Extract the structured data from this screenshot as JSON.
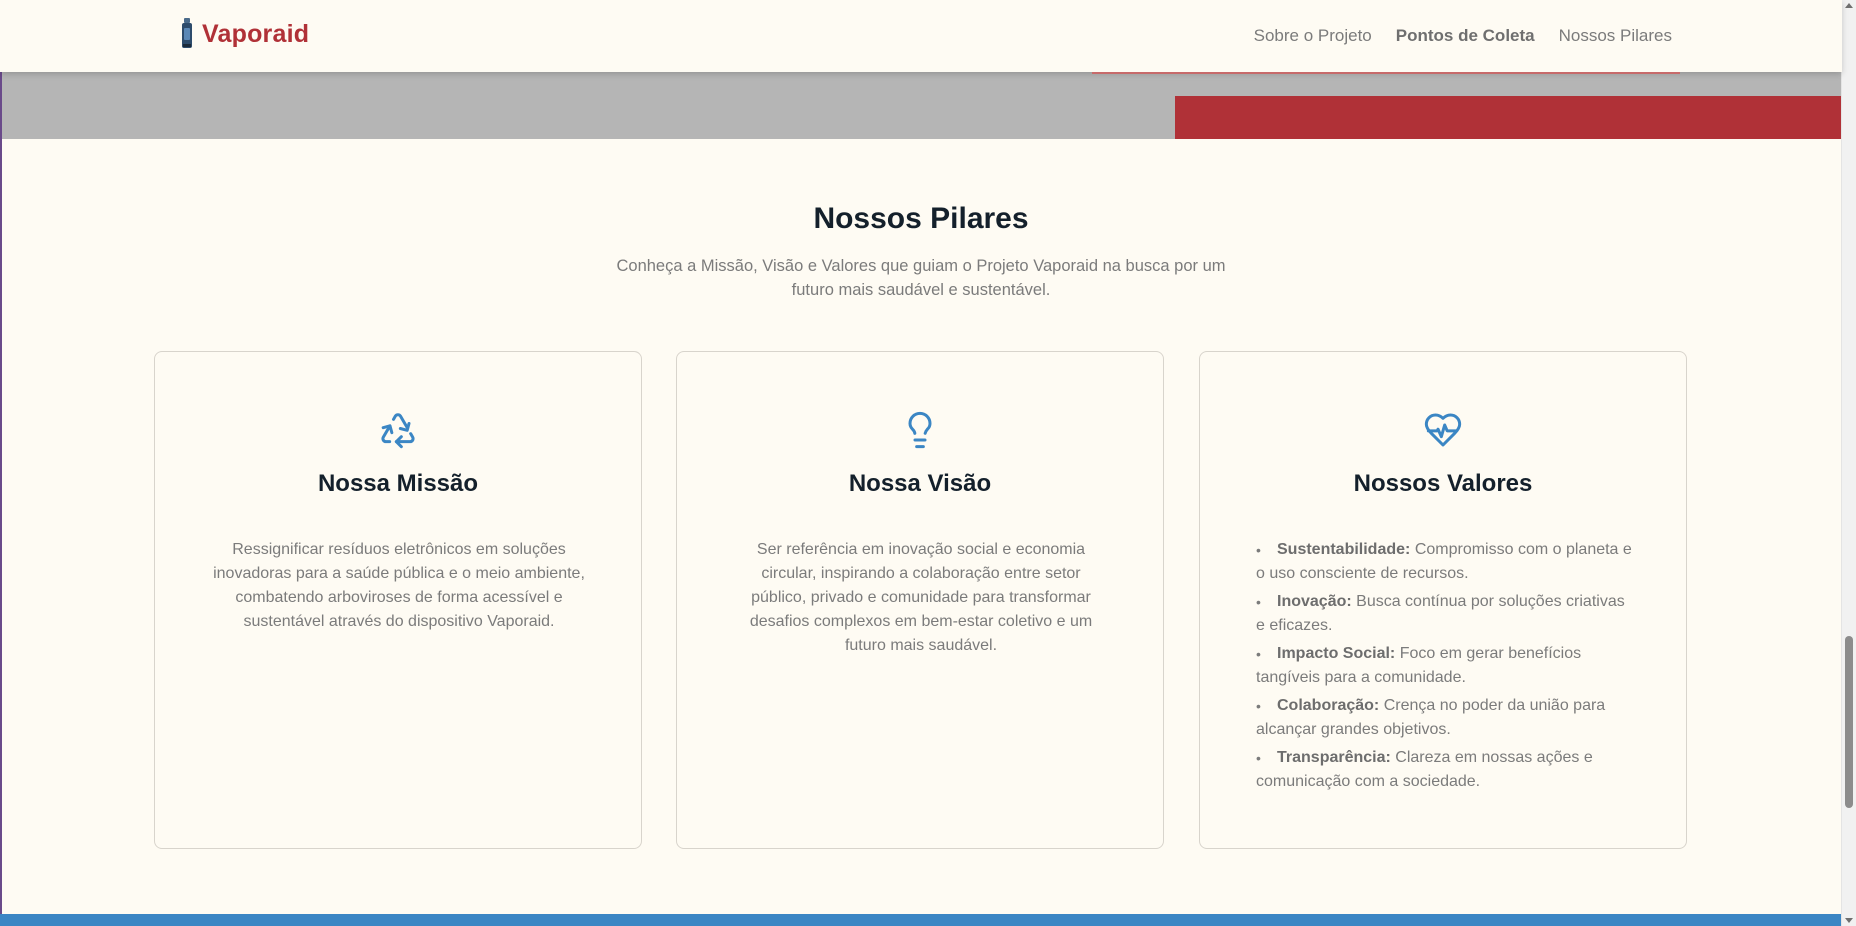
{
  "header": {
    "brand_name": "Vaporaid",
    "brand_icon": "device-bottle-icon",
    "nav": [
      {
        "label": "Sobre o Projeto",
        "active": false
      },
      {
        "label": "Pontos de Coleta",
        "active": true
      },
      {
        "label": "Nossos Pilares",
        "active": false
      }
    ]
  },
  "section": {
    "title": "Nossos Pilares",
    "subtitle": "Conheça a Missão, Visão e Valores que guiam o Projeto Vaporaid na busca por um futuro mais saudável e sustentável."
  },
  "cards": [
    {
      "icon": "recycle-icon",
      "title": "Nossa Missão",
      "text": "Ressignificar resíduos eletrônicos em soluções inovadoras para a saúde pública e o meio ambiente, combatendo arboviroses de forma acessível e sustentável através do dispositivo Vaporaid."
    },
    {
      "icon": "lightbulb-icon",
      "title": "Nossa Visão",
      "text": "Ser referência em inovação social e economia circular, inspirando a colaboração entre setor público, privado e comunidade para transformar desafios complexos em bem-estar coletivo e um futuro mais saudável."
    },
    {
      "icon": "heart-pulse-icon",
      "title": "Nossos Valores",
      "values": [
        {
          "name": "Sustentabilidade:",
          "desc": "Compromisso com o planeta e o uso consciente de recursos."
        },
        {
          "name": "Inovação:",
          "desc": "Busca contínua por soluções criativas e eficazes."
        },
        {
          "name": "Impacto Social:",
          "desc": "Foco em gerar benefícios tangíveis para a comunidade."
        },
        {
          "name": "Colaboração:",
          "desc": "Crença no poder da união para alcançar grandes objetivos."
        },
        {
          "name": "Transparência:",
          "desc": "Clareza em nossas ações e comunicação com a sociedade."
        }
      ]
    }
  ],
  "colors": {
    "brand": "#b03137",
    "icon_accent": "#3b86c4",
    "background": "#fefbf3",
    "footer": "#3b86c4"
  }
}
